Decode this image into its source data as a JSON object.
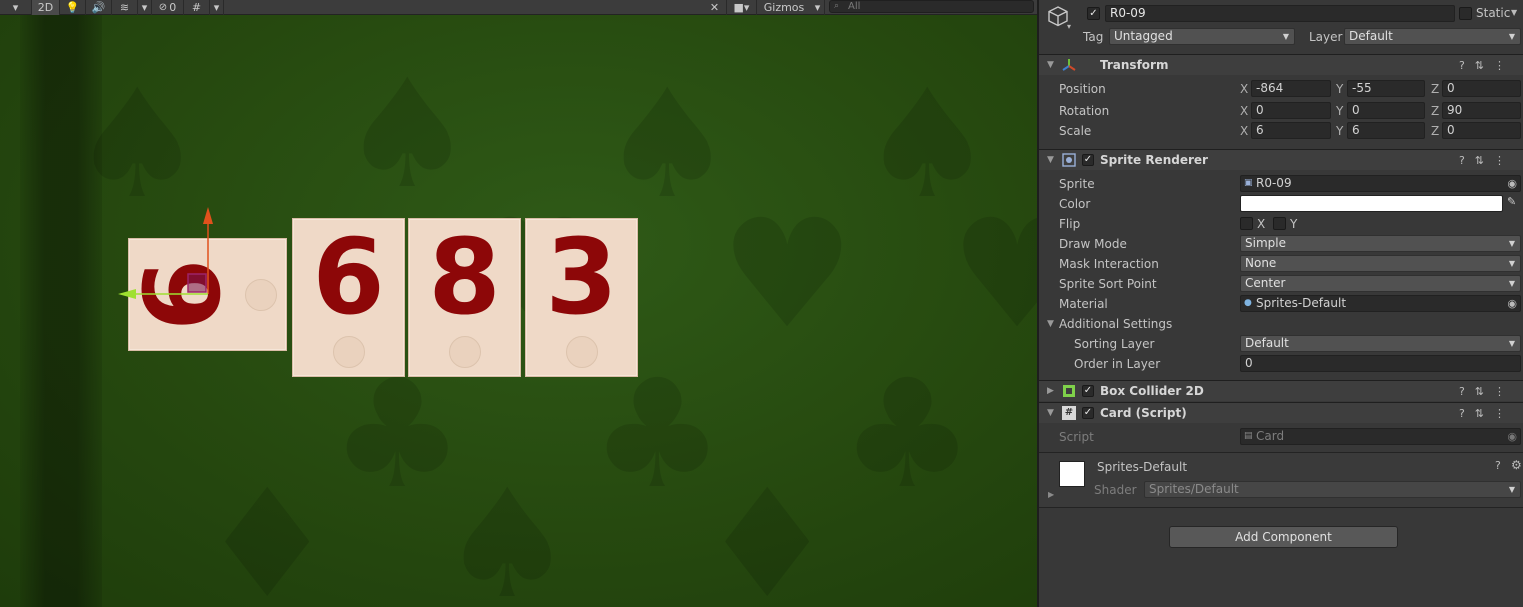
{
  "scene_toolbar": {
    "mode_2d": "2D",
    "hidden_count": "0",
    "gizmos_label": "Gizmos",
    "search_placeholder": "All"
  },
  "scene": {
    "cards": [
      {
        "value": "9",
        "rotated": true
      },
      {
        "value": "6",
        "rotated": false
      },
      {
        "value": "8",
        "rotated": false
      },
      {
        "value": "3",
        "rotated": false
      }
    ]
  },
  "inspector": {
    "object_name": "R0-09",
    "static_label": "Static",
    "tag_label": "Tag",
    "tag_value": "Untagged",
    "layer_label": "Layer",
    "layer_value": "Default",
    "transform": {
      "title": "Transform",
      "position_label": "Position",
      "rotation_label": "Rotation",
      "scale_label": "Scale",
      "position": {
        "x": "-864",
        "y": "-55",
        "z": "0"
      },
      "rotation": {
        "x": "0",
        "y": "0",
        "z": "90"
      },
      "scale": {
        "x": "6",
        "y": "6",
        "z": "0"
      }
    },
    "sprite_renderer": {
      "title": "Sprite Renderer",
      "sprite_label": "Sprite",
      "sprite_value": "R0-09",
      "color_label": "Color",
      "color_value": "#ffffff",
      "flip_label": "Flip",
      "flip_x": "X",
      "flip_y": "Y",
      "draw_mode_label": "Draw Mode",
      "draw_mode_value": "Simple",
      "mask_label": "Mask Interaction",
      "mask_value": "None",
      "sort_point_label": "Sprite Sort Point",
      "sort_point_value": "Center",
      "material_label": "Material",
      "material_value": "Sprites-Default",
      "additional_label": "Additional Settings",
      "sorting_layer_label": "Sorting Layer",
      "sorting_layer_value": "Default",
      "order_label": "Order in Layer",
      "order_value": "0"
    },
    "box_collider": {
      "title": "Box Collider 2D"
    },
    "card_script": {
      "title": "Card (Script)",
      "script_label": "Script",
      "script_value": "Card"
    },
    "material_preview": {
      "name": "Sprites-Default",
      "shader_label": "Shader",
      "shader_value": "Sprites/Default"
    },
    "add_component_label": "Add Component"
  }
}
